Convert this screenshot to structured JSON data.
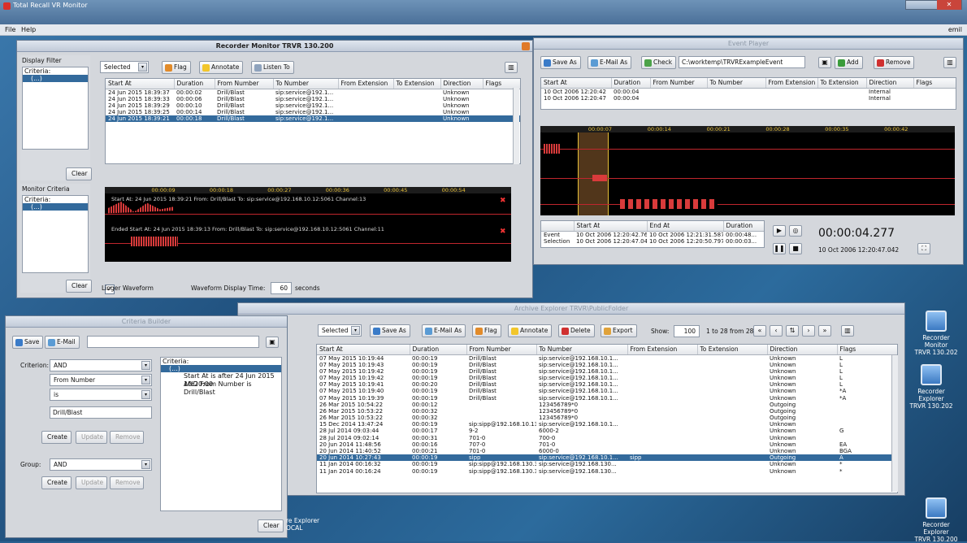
{
  "app": {
    "title": "Total Recall VR Monitor",
    "menu": [
      "File",
      "Help"
    ],
    "user": "emil"
  },
  "recorder_monitor": {
    "title": "Recorder Monitor TRVR 130.200",
    "display_filter": {
      "label": "Display Filter",
      "criteria": "Criteria:",
      "node": "(...)",
      "clear": "Clear"
    },
    "monitor_criteria": {
      "label": "Monitor Criteria",
      "criteria": "Criteria:",
      "node": "(...)",
      "clear": "Clear"
    },
    "toolbar": {
      "select": "Selected",
      "flag": "Flag",
      "annotate": "Annotate",
      "listen": "Listen To"
    },
    "columns": [
      "Start At",
      "Duration",
      "From Number",
      "To Number",
      "From Extension",
      "To Extension",
      "Direction",
      "Flags"
    ],
    "rows": [
      [
        "24 Jun 2015 18:39:37",
        "00:00:02",
        "Drill/Blast",
        "sip:service@192.1...",
        "",
        "",
        "Unknown",
        ""
      ],
      [
        "24 Jun 2015 18:39:33",
        "00:00:06",
        "Drill/Blast",
        "sip:service@192.1...",
        "",
        "",
        "Unknown",
        ""
      ],
      [
        "24 Jun 2015 18:39:29",
        "00:00:10",
        "Drill/Blast",
        "sip:service@192.1...",
        "",
        "",
        "Unknown",
        ""
      ],
      [
        "24 Jun 2015 18:39:25",
        "00:00:14",
        "Drill/Blast",
        "sip:service@192.1...",
        "",
        "",
        "Unknown",
        ""
      ],
      [
        "24 Jun 2015 18:39:21",
        "00:00:18",
        "Drill/Blast",
        "sip:service@192.1...",
        "",
        "",
        "Unknown",
        ""
      ]
    ],
    "timeline": [
      "00:00:09",
      "00:00:18",
      "00:00:27",
      "00:00:36",
      "00:00:45",
      "00:00:54"
    ],
    "wave1": "Start At: 24 Jun 2015 18:39:21   From: Drill/Blast   To: sip:service@192.168.10.12:5061   Channel:13",
    "wave2": "Ended   Start At: 24 Jun 2015 18:39:13   From: Drill/Blast   To: sip:service@192.168.10.12:5061   Channel:11",
    "linger": "Linger Waveform",
    "display_time_label": "Waveform Display Time:",
    "display_time": "60",
    "seconds": "seconds"
  },
  "event_player": {
    "title": "Event Player",
    "toolbar": {
      "save": "Save As",
      "email": "E-Mail As",
      "check": "Check",
      "path": "C:\\worktemp\\TRVRExampleEvent",
      "add": "Add",
      "remove": "Remove"
    },
    "columns": [
      "Start At",
      "Duration",
      "From Number",
      "To Number",
      "From Extension",
      "To Extension",
      "Direction",
      "Flags"
    ],
    "rows": [
      [
        "10 Oct 2006 12:20:42",
        "00:00:04",
        "",
        "",
        "",
        "",
        "Internal",
        ""
      ],
      [
        "10 Oct 2006 12:20:47",
        "00:00:04",
        "",
        "",
        "",
        "",
        "Internal",
        ""
      ]
    ],
    "timeline": [
      "00:00:07",
      "00:00:14",
      "00:00:21",
      "00:00:28",
      "00:00:35",
      "00:00:42"
    ],
    "info_cols": [
      "",
      "Start At",
      "End At",
      "Duration"
    ],
    "info_rows": [
      [
        "Event",
        "10 Oct 2006 12:20:42.765",
        "10 Oct 2006 12:21:31.587",
        "00:00:48..."
      ],
      [
        "Selection",
        "10 Oct 2006 12:20:47.042",
        "10 Oct 2006 12:20:50.797",
        "00:00:03..."
      ]
    ],
    "clock": "00:00:04.277",
    "clock_date": "10 Oct 2006 12:20:47.042"
  },
  "criteria_builder": {
    "title": "Criteria Builder",
    "save": "Save",
    "email": "E-Mail",
    "criterion_label": "Criterion:",
    "criterion": "AND",
    "field": "From Number",
    "op": "is",
    "value": "Drill/Blast",
    "create": "Create",
    "update": "Update",
    "remove": "Remove",
    "group_label": "Group:",
    "group": "AND",
    "tree": {
      "root": "Criteria:",
      "node": "(...)",
      "c1": "Start At is after 24 Jun 2015 10:20:00",
      "c2": "AND From Number is Drill/Blast"
    },
    "clear": "Clear"
  },
  "archive_explorer": {
    "title": "Archive Explorer TRVR\\PublicFolder",
    "toolbar": {
      "select": "Selected",
      "save": "Save As",
      "email": "E-Mail As",
      "flag": "Flag",
      "annotate": "Annotate",
      "delete": "Delete",
      "export": "Export",
      "show_label": "Show:",
      "show": "100",
      "range": "1 to 28 from 28"
    },
    "columns": [
      "Start At",
      "Duration",
      "From Number",
      "To Number",
      "From Extension",
      "To Extension",
      "Direction",
      "Flags"
    ],
    "rows": [
      [
        "07 May 2015 10:19:44",
        "00:00:19",
        "Drill/Blast",
        "sip:service@192.168.10.1...",
        "",
        "",
        "Unknown",
        "L"
      ],
      [
        "07 May 2015 10:19:43",
        "00:00:19",
        "Drill/Blast",
        "sip:service@192.168.10.1...",
        "",
        "",
        "Unknown",
        "L"
      ],
      [
        "07 May 2015 10:19:42",
        "00:00:19",
        "Drill/Blast",
        "sip:service@192.168.10.1...",
        "",
        "",
        "Unknown",
        "L"
      ],
      [
        "07 May 2015 10:19:42",
        "00:00:19",
        "Drill/Blast",
        "sip:service@192.168.10.1...",
        "",
        "",
        "Unknown",
        "L"
      ],
      [
        "07 May 2015 10:19:41",
        "00:00:20",
        "Drill/Blast",
        "sip:service@192.168.10.1...",
        "",
        "",
        "Unknown",
        "L"
      ],
      [
        "07 May 2015 10:19:40",
        "00:00:19",
        "Drill/Blast",
        "sip:service@192.168.10.1...",
        "",
        "",
        "Unknown",
        "*A"
      ],
      [
        "07 May 2015 10:19:39",
        "00:00:19",
        "Drill/Blast",
        "sip:service@192.168.10.1...",
        "",
        "",
        "Unknown",
        "*A"
      ],
      [
        "26 Mar 2015 10:54:22",
        "00:00:12",
        "",
        "123456789*0",
        "",
        "",
        "Outgoing",
        ""
      ],
      [
        "26 Mar 2015 10:53:22",
        "00:00:32",
        "",
        "123456789*0",
        "",
        "",
        "Outgoing",
        ""
      ],
      [
        "26 Mar 2015 10:53:22",
        "00:00:32",
        "",
        "123456789*0",
        "",
        "",
        "Outgoing",
        ""
      ],
      [
        "15 Dec 2014 13:47:24",
        "00:00:19",
        "sip:sipp@192.168.10.13:...",
        "sip:service@192.168.10.1...",
        "",
        "",
        "Unknown",
        ""
      ],
      [
        "28 Jul 2014 09:03:44",
        "00:00:17",
        "9-2",
        "6000-2",
        "",
        "",
        "Unknown",
        "G"
      ],
      [
        "28 Jul 2014 09:02:14",
        "00:00:31",
        "701-0",
        "700-0",
        "",
        "",
        "Unknown",
        ""
      ],
      [
        "20 Jun 2014 11:48:56",
        "00:00:16",
        "707-0",
        "701-0",
        "",
        "",
        "Unknown",
        "EA"
      ],
      [
        "20 Jun 2014 11:40:52",
        "00:00:21",
        "701-0",
        "6000-0",
        "",
        "",
        "Unknown",
        "BGA"
      ],
      [
        "20 Jun 2014 10:27:43",
        "00:00:19",
        "sipp",
        "sip:service@192.168.10.1...",
        "sipp",
        "",
        "Outgoing",
        "A"
      ],
      [
        "11 Jan 2014 00:16:32",
        "00:00:19",
        "sip:sipp@192.168.130.3:...",
        "sip:service@192.168.130...",
        "",
        "",
        "Unknown",
        "*"
      ],
      [
        "11 Jan 2014 00:16:24",
        "00:00:19",
        "sip:sipp@192.168.130.3:...",
        "sip:service@192.168.130...",
        "",
        "",
        "Unknown",
        "*"
      ]
    ],
    "selected_row": 15
  },
  "desktop": {
    "icons": [
      {
        "label": "Recorder Monitor",
        "sub": "TRVR 130.202"
      },
      {
        "label": "Recorder Explorer",
        "sub": "TRVR 130.202"
      },
      {
        "label": "Recorder Explorer",
        "sub": "TRVR 130.200"
      }
    ],
    "partial": [
      "re Explorer",
      "OCAL"
    ]
  }
}
